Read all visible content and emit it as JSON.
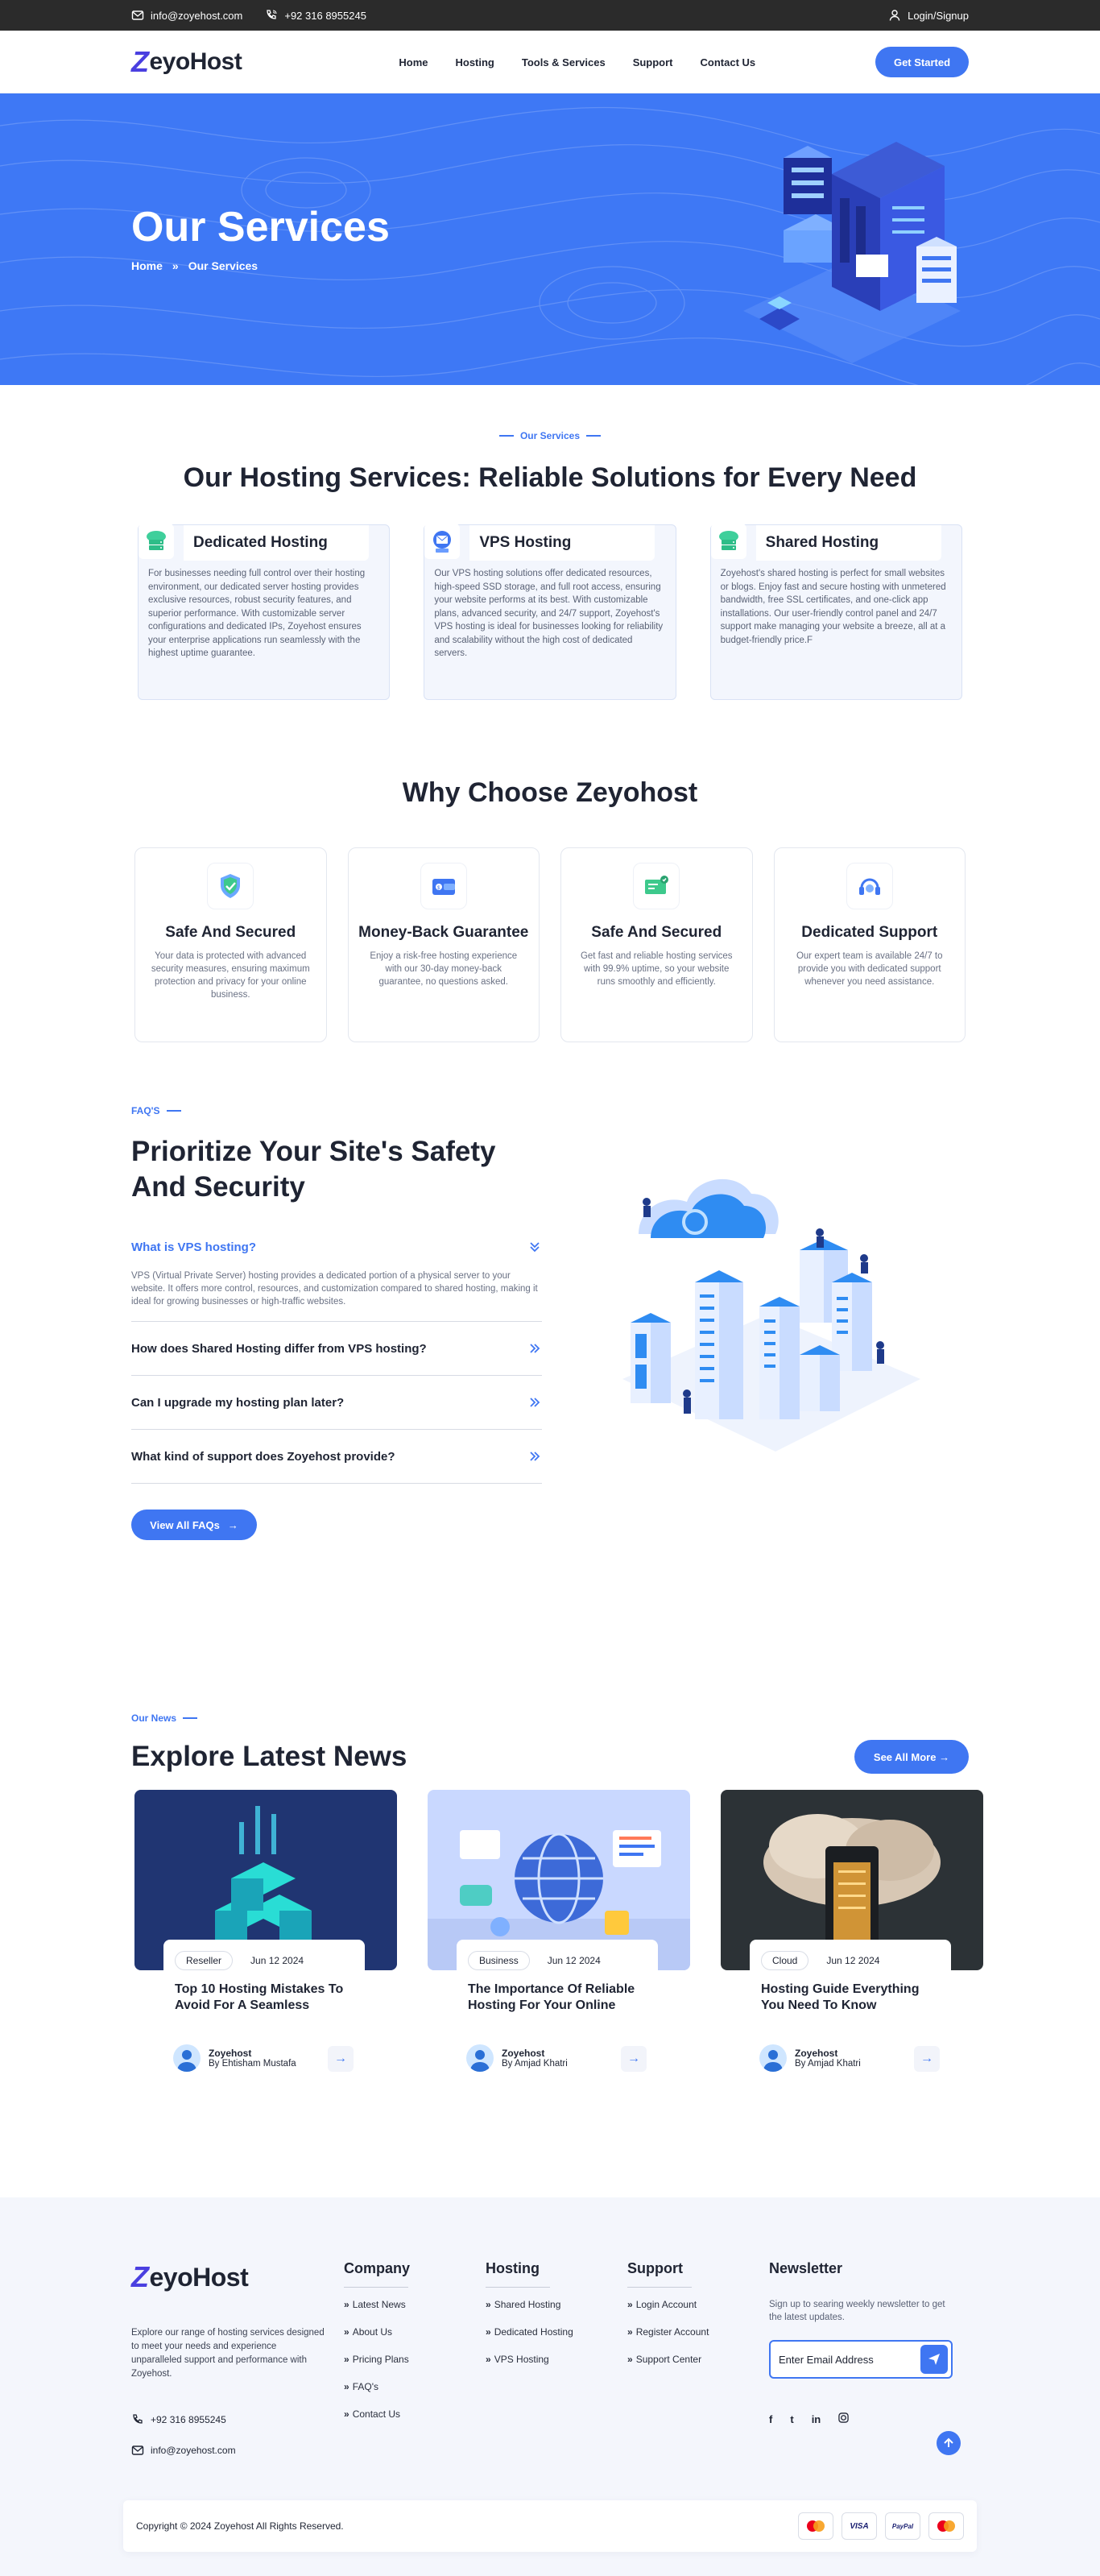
{
  "topbar": {
    "email": "info@zoyehost.com",
    "phone": "+92 316 8955245",
    "login": "Login/Signup"
  },
  "header": {
    "logo_mark": "Z",
    "logo_text": "eyoHost",
    "nav": [
      "Home",
      "Hosting",
      "Tools & Services",
      "Support",
      "Contact Us"
    ],
    "cta": "Get Started"
  },
  "hero": {
    "title": "Our Services",
    "crumb_home": "Home",
    "crumb_current": "Our Services"
  },
  "services": {
    "eyebrow": "Our Services",
    "title": "Our Hosting Services: Reliable Solutions for Every Need",
    "cards": [
      {
        "title": "Dedicated Hosting",
        "icon": "server-cloud-icon",
        "text": "For businesses needing full control over their hosting environment, our dedicated server hosting provides exclusive resources, robust security features, and superior performance. With customizable server configurations and dedicated IPs, Zoyehost ensures your enterprise applications run seamlessly with the highest uptime guarantee."
      },
      {
        "title": "VPS Hosting",
        "icon": "mail-server-icon",
        "text": "Our VPS hosting solutions offer dedicated resources, high-speed SSD storage, and full root access, ensuring your website performs at its best. With customizable plans, advanced security, and 24/7 support, Zoyehost's VPS hosting is ideal for businesses looking for reliability and scalability without the high cost of dedicated servers."
      },
      {
        "title": "Shared Hosting",
        "icon": "server-cloud-icon",
        "text": "Zoyehost's shared hosting is perfect for small websites or blogs. Enjoy fast and secure hosting with unmetered bandwidth, free SSL certificates, and one-click app installations. Our user-friendly control panel and 24/7 support make managing your website a breeze, all at a budget-friendly price.F"
      }
    ]
  },
  "why": {
    "title": "Why Choose Zeyohost",
    "cards": [
      {
        "title": "Safe And Secured",
        "icon": "shield-check-icon",
        "text": "Your data is protected with advanced security measures, ensuring maximum protection and privacy for your online business."
      },
      {
        "title": "Money-Back Guarantee",
        "icon": "wallet-icon",
        "text": "Enjoy a risk-free hosting experience with our 30-day money-back guarantee, no questions asked."
      },
      {
        "title": "Safe And Secured",
        "icon": "money-check-icon",
        "text": "Get fast and reliable hosting services with 99.9% uptime, so your website runs smoothly and efficiently."
      },
      {
        "title": "Dedicated Support",
        "icon": "headset-icon",
        "text": "Our expert team is available 24/7 to provide you with dedicated support whenever you need assistance."
      }
    ]
  },
  "faq": {
    "eyebrow": "FAQ'S",
    "title_line1": "Prioritize Your Site's Safety",
    "title_line2": "And Security",
    "items": [
      {
        "q": "What is VPS hosting?",
        "a": "VPS (Virtual Private Server) hosting provides a dedicated portion of a physical server to your website. It offers more control, resources, and customization compared to shared hosting, making it ideal for growing businesses or high-traffic websites."
      },
      {
        "q": "How does Shared Hosting differ from VPS hosting?"
      },
      {
        "q": "Can I upgrade my hosting plan later?"
      },
      {
        "q": "What kind of support does Zoyehost provide?"
      }
    ],
    "button": "View All FAQs"
  },
  "news": {
    "eyebrow": "Our News",
    "title": "Explore Latest News",
    "button": "See All More",
    "cards": [
      {
        "category": "Reseller",
        "date": "Jun 12 2024",
        "title": "Top 10 Hosting Mistakes To Avoid For A Seamless",
        "author_name": "Zoyehost",
        "author_by": "By Ehtisham Mustafa"
      },
      {
        "category": "Business",
        "date": "Jun 12 2024",
        "title": "The Importance Of Reliable Hosting For Your Online",
        "author_name": "Zoyehost",
        "author_by": "By Amjad Khatri"
      },
      {
        "category": "Cloud",
        "date": "Jun 12 2024",
        "title": "Hosting Guide Everything You Need To Know",
        "author_name": "Zoyehost",
        "author_by": "By Amjad Khatri"
      }
    ]
  },
  "footer": {
    "logo_mark": "Z",
    "logo_text": "eyoHost",
    "about": "Explore our range of hosting services designed to meet your needs and experience unparalleled support and performance with Zoyehost.",
    "phone": "+92 316 8955245",
    "email": "info@zoyehost.com",
    "company": {
      "title": "Company",
      "links": [
        "Latest News",
        "About Us",
        "Pricing Plans",
        "FAQ's",
        "Contact Us"
      ]
    },
    "hosting": {
      "title": "Hosting",
      "links": [
        "Shared Hosting",
        "Dedicated Hosting",
        "VPS Hosting"
      ]
    },
    "support": {
      "title": "Support",
      "links": [
        "Login Account",
        "Register Account",
        "Support Center"
      ]
    },
    "newsletter": {
      "title": "Newsletter",
      "text": "Sign up to searing weekly newsletter to get the latest updates.",
      "placeholder": "Enter Email Address"
    },
    "social": [
      "f",
      "t",
      "in",
      "ig"
    ],
    "copyright": "Copyright © 2024 Zoyehost All Rights Reserved.",
    "payments": [
      "mastercard",
      "VISA",
      "PayPal",
      "mastercard"
    ]
  }
}
